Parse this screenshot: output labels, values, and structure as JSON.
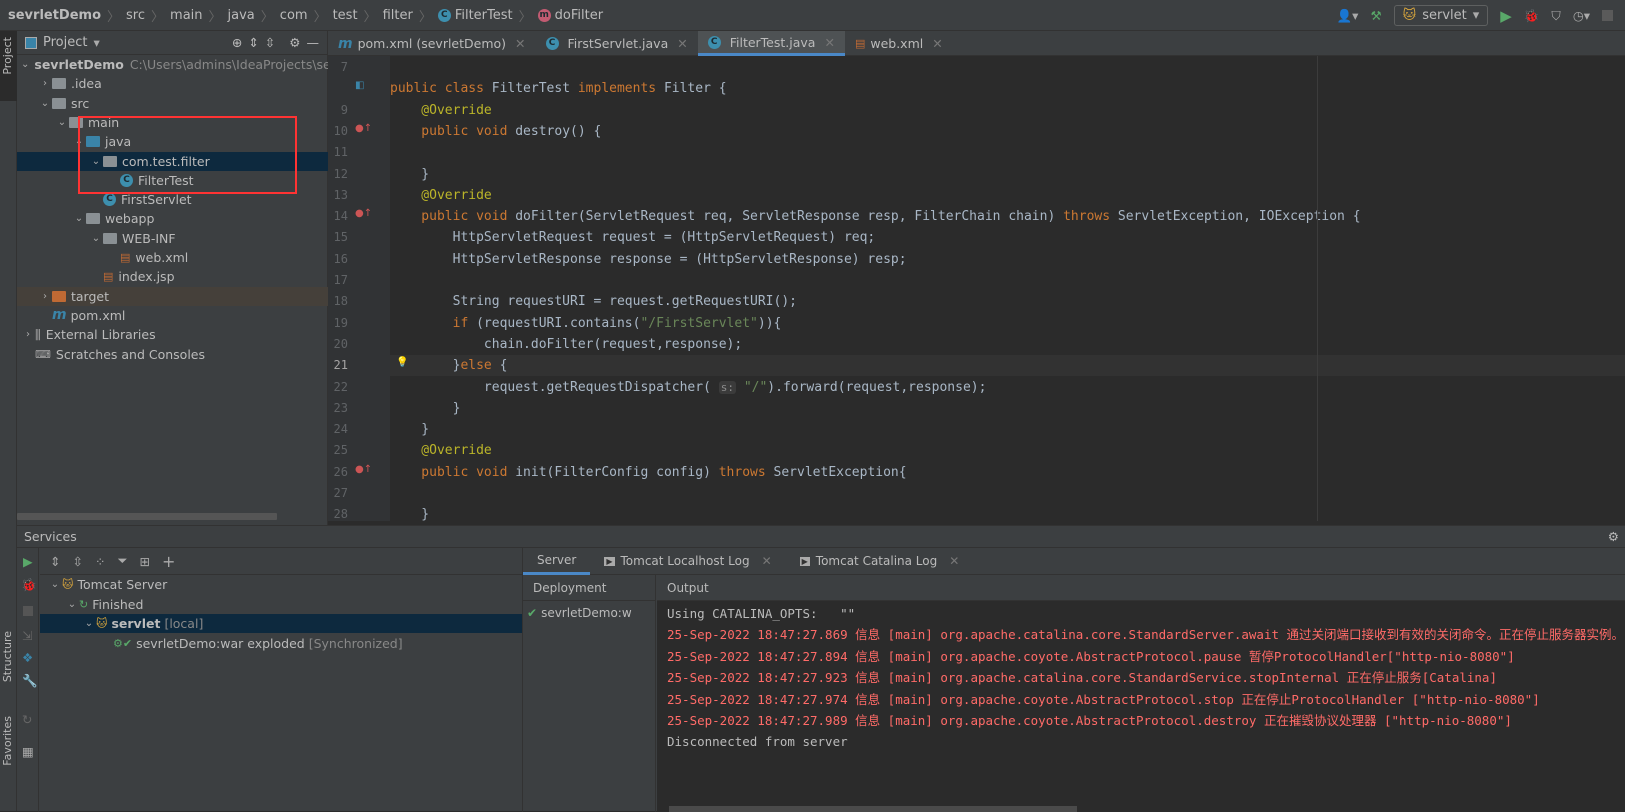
{
  "breadcrumb": [
    "sevrletDemo",
    "src",
    "main",
    "java",
    "com",
    "test",
    "filter",
    "FilterTest",
    "doFilter"
  ],
  "toolbar": {
    "run_config": "servlet"
  },
  "left_stripe": {
    "project": "Project",
    "structure": "Structure",
    "favorites": "Favorites"
  },
  "project": {
    "title": "Project",
    "tree": [
      {
        "label": "sevrletDemo",
        "path": "C:\\Users\\admins\\IdeaProjects\\sevrletDemo",
        "depth": 0,
        "arrow": "down",
        "icon": "module-folder",
        "bold": true
      },
      {
        "label": ".idea",
        "depth": 1,
        "arrow": "right",
        "icon": "folder"
      },
      {
        "label": "src",
        "depth": 1,
        "arrow": "down",
        "icon": "folder"
      },
      {
        "label": "main",
        "depth": 2,
        "arrow": "down",
        "icon": "folder"
      },
      {
        "label": "java",
        "depth": 3,
        "arrow": "down",
        "icon": "source-folder"
      },
      {
        "label": "com.test.filter",
        "depth": 4,
        "arrow": "down",
        "icon": "package",
        "selected": true
      },
      {
        "label": "FilterTest",
        "depth": 5,
        "icon": "class"
      },
      {
        "label": "FirstServlet",
        "depth": 4,
        "icon": "class"
      },
      {
        "label": "webapp",
        "depth": 3,
        "arrow": "down",
        "icon": "web-folder"
      },
      {
        "label": "WEB-INF",
        "depth": 4,
        "arrow": "down",
        "icon": "folder"
      },
      {
        "label": "web.xml",
        "depth": 5,
        "icon": "xml-file"
      },
      {
        "label": "index.jsp",
        "depth": 4,
        "icon": "jsp-file"
      },
      {
        "label": "target",
        "depth": 1,
        "arrow": "right",
        "icon": "excluded-folder",
        "excluded": true
      },
      {
        "label": "pom.xml",
        "depth": 1,
        "icon": "maven-file"
      },
      {
        "label": "External Libraries",
        "depth": 0,
        "arrow": "right",
        "icon": "libraries"
      },
      {
        "label": "Scratches and Consoles",
        "depth": 0,
        "icon": "scratches"
      }
    ]
  },
  "tabs": [
    {
      "label": "pom.xml (sevrletDemo)",
      "icon": "maven"
    },
    {
      "label": "FirstServlet.java",
      "icon": "class"
    },
    {
      "label": "FilterTest.java",
      "icon": "class",
      "active": true
    },
    {
      "label": "web.xml",
      "icon": "xml"
    }
  ],
  "editor": {
    "current_line": 21,
    "lines": [
      {
        "n": "7",
        "t": []
      },
      {
        "n": "",
        "t": [
          [
            "public class ",
            "kw"
          ],
          [
            "FilterTest ",
            "pl"
          ],
          [
            "implements ",
            "kw"
          ],
          [
            "Filter {",
            "pl"
          ]
        ]
      },
      {
        "n": "9",
        "t": [
          [
            "    @Override",
            "ann"
          ]
        ]
      },
      {
        "n": "10",
        "t": [
          [
            "    public void ",
            "kw"
          ],
          [
            "destroy() {",
            "pl"
          ]
        ]
      },
      {
        "n": "11",
        "t": []
      },
      {
        "n": "12",
        "t": [
          [
            "    }",
            "pl"
          ]
        ]
      },
      {
        "n": "13",
        "t": [
          [
            "    @Override",
            "ann"
          ]
        ]
      },
      {
        "n": "14",
        "t": [
          [
            "    public void ",
            "kw"
          ],
          [
            "doFilter(ServletRequest req, ServletResponse resp, FilterChain chain) ",
            "pl"
          ],
          [
            "throws ",
            "kw"
          ],
          [
            "ServletException, IOException {",
            "pl"
          ]
        ]
      },
      {
        "n": "15",
        "t": [
          [
            "        HttpServletRequest request = (HttpServletRequest) req;",
            "pl"
          ]
        ]
      },
      {
        "n": "16",
        "t": [
          [
            "        HttpServletResponse response = (HttpServletResponse) resp;",
            "pl"
          ]
        ]
      },
      {
        "n": "17",
        "t": []
      },
      {
        "n": "18",
        "t": [
          [
            "        String requestURI = request.getRequestURI();",
            "pl"
          ]
        ]
      },
      {
        "n": "19",
        "t": [
          [
            "        if ",
            "kw"
          ],
          [
            "(requestURI.contains(",
            "pl"
          ],
          [
            "\"/FirstServlet\"",
            "str"
          ],
          [
            ")){",
            "pl"
          ]
        ]
      },
      {
        "n": "20",
        "t": [
          [
            "            chain.doFilter(request,response);",
            "pl"
          ]
        ]
      },
      {
        "n": "21",
        "t": [
          [
            "        }",
            "pl"
          ],
          [
            "else ",
            "kw"
          ],
          [
            "{",
            "pl"
          ]
        ]
      },
      {
        "n": "22",
        "t": [
          [
            "            request.getRequestDispatcher( ",
            "pl"
          ],
          [
            "s:",
            "hint"
          ],
          [
            " ",
            "pl"
          ],
          [
            "\"/\"",
            "str"
          ],
          [
            ").forward(request,response);",
            "pl"
          ]
        ]
      },
      {
        "n": "23",
        "t": [
          [
            "        }",
            "pl"
          ]
        ]
      },
      {
        "n": "24",
        "t": [
          [
            "    }",
            "pl"
          ]
        ]
      },
      {
        "n": "25",
        "t": [
          [
            "    @Override",
            "ann"
          ]
        ]
      },
      {
        "n": "26",
        "t": [
          [
            "    public void ",
            "kw"
          ],
          [
            "init(FilterConfig config) ",
            "pl"
          ],
          [
            "throws ",
            "kw"
          ],
          [
            "ServletException{",
            "pl"
          ]
        ]
      },
      {
        "n": "27",
        "t": []
      },
      {
        "n": "28",
        "t": [
          [
            "    }",
            "pl"
          ]
        ]
      }
    ]
  },
  "services": {
    "title": "Services",
    "tree": [
      {
        "label": "Tomcat Server",
        "depth": 0,
        "arrow": "down"
      },
      {
        "label": "Finished",
        "depth": 1,
        "arrow": "down"
      },
      {
        "label": "servlet",
        "suffix": "[local]",
        "depth": 2,
        "arrow": "down",
        "selected": true
      },
      {
        "label": "sevrletDemo:war exploded",
        "suffix": "[Synchronized]",
        "depth": 3
      }
    ],
    "tabs": [
      "Server",
      "Tomcat Localhost Log",
      "Tomcat Catalina Log"
    ],
    "deployment_header": "Deployment",
    "deployment_item": "sevrletDemo:w",
    "output_header": "Output",
    "log": [
      {
        "text": "Using CATALINA_OPTS:   \"\"",
        "level": "info"
      },
      {
        "text": "25-Sep-2022 18:47:27.869 信息 [main] org.apache.catalina.core.StandardServer.await 通过关闭端口接收到有效的关闭命令。正在停止服务器实例。",
        "level": "err"
      },
      {
        "text": "25-Sep-2022 18:47:27.894 信息 [main] org.apache.coyote.AbstractProtocol.pause 暂停ProtocolHandler[\"http-nio-8080\"]",
        "level": "err"
      },
      {
        "text": "25-Sep-2022 18:47:27.923 信息 [main] org.apache.catalina.core.StandardService.stopInternal 正在停止服务[Catalina]",
        "level": "err"
      },
      {
        "text": "25-Sep-2022 18:47:27.974 信息 [main] org.apache.coyote.AbstractProtocol.stop 正在停止ProtocolHandler [\"http-nio-8080\"]",
        "level": "err"
      },
      {
        "text": "25-Sep-2022 18:47:27.989 信息 [main] org.apache.coyote.AbstractProtocol.destroy 正在摧毁协议处理器 [\"http-nio-8080\"]",
        "level": "err"
      },
      {
        "text": "Disconnected from server",
        "level": "info"
      }
    ]
  }
}
